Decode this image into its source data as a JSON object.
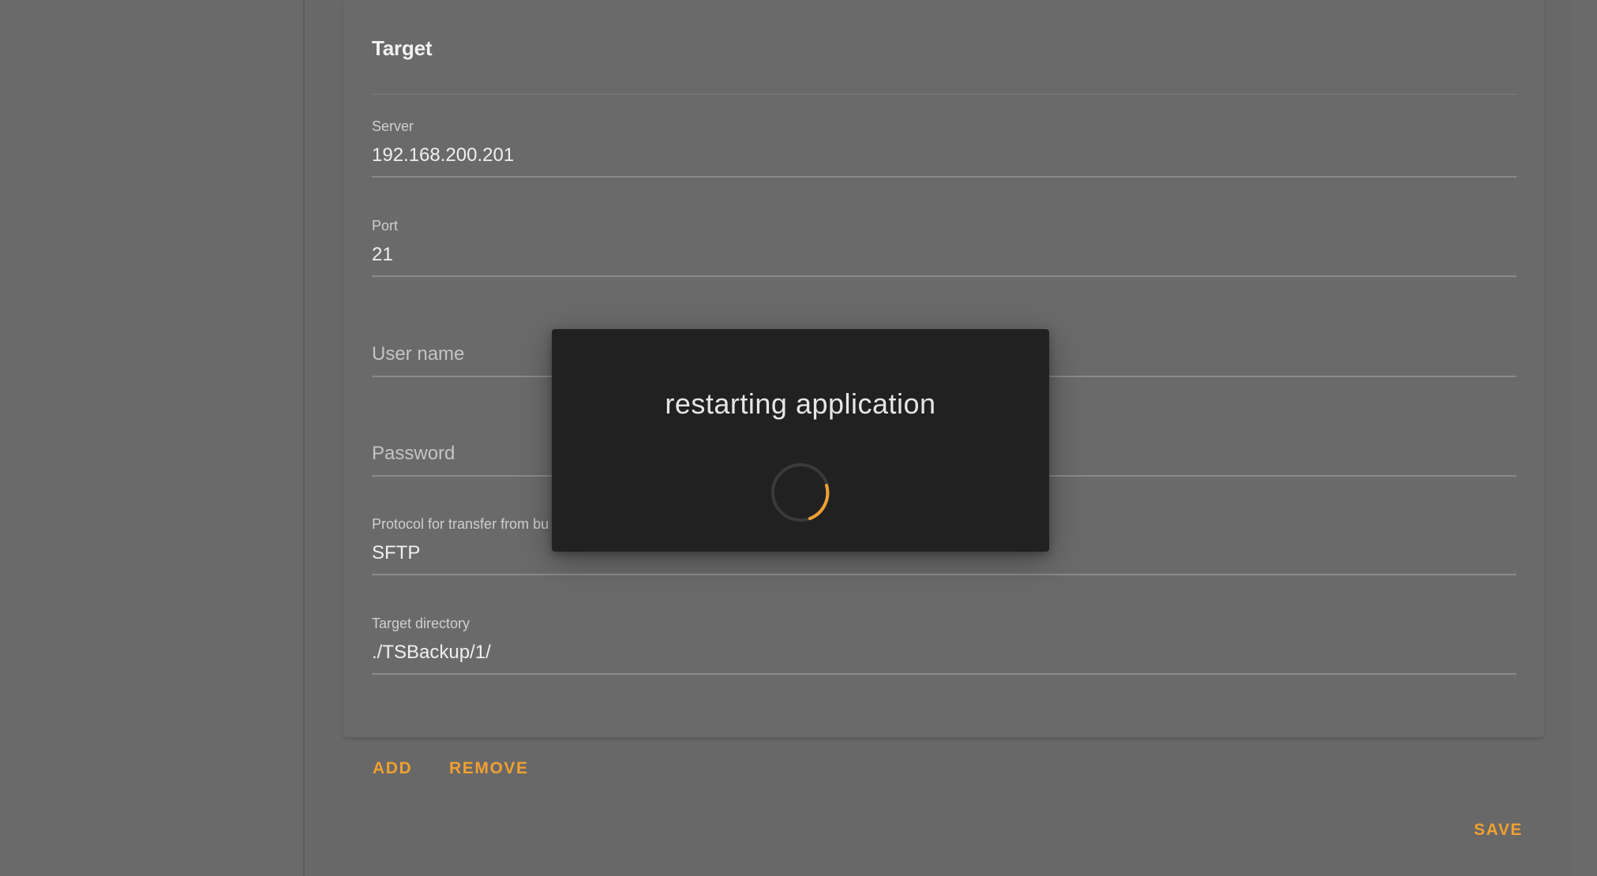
{
  "card": {
    "title": "Target"
  },
  "fields": {
    "server": {
      "label": "Server",
      "value": "192.168.200.201"
    },
    "port": {
      "label": "Port",
      "value": "21"
    },
    "username": {
      "placeholder": "User name"
    },
    "password": {
      "placeholder": "Password"
    },
    "protocol": {
      "label": "Protocol for transfer from bu",
      "value": "SFTP"
    },
    "target_directory": {
      "label": "Target directory",
      "value": "./TSBackup/1/"
    }
  },
  "actions": {
    "add_label": "ADD",
    "remove_label": "REMOVE",
    "save_label": "SAVE"
  },
  "dialog": {
    "message": "restarting application",
    "spinner_icon": "spinner-icon",
    "accent_color": "#f0a030",
    "background_color": "#212121"
  }
}
